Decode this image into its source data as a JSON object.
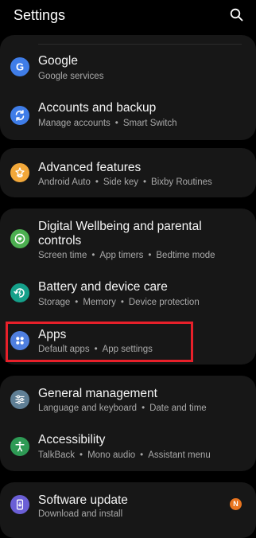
{
  "header": {
    "title": "Settings",
    "search_icon": "search-icon"
  },
  "colors": {
    "background": "#000000",
    "card": "#171717",
    "highlight": "#e8202a",
    "badge": "#e8741f",
    "google": "#3f7de8",
    "accounts": "#3f7de8",
    "advanced": "#f2a83a",
    "wellbeing": "#4caf50",
    "battery": "#15a08a",
    "apps": "#4f7fe0",
    "general": "#5f7f95",
    "accessibility": "#2e9a55",
    "software_update": "#6b5fd6"
  },
  "items": [
    {
      "label": "Google",
      "subs": [
        "Google services"
      ],
      "icon": "google-icon"
    },
    {
      "label": "Accounts and backup",
      "subs": [
        "Manage accounts",
        "Smart Switch"
      ],
      "icon": "sync-icon"
    },
    {
      "label": "Advanced features",
      "subs": [
        "Android Auto",
        "Side key",
        "Bixby Routines"
      ],
      "icon": "advanced-features-icon"
    },
    {
      "label_line1": "Digital Wellbeing and parental",
      "label_line2": "controls",
      "subs": [
        "Screen time",
        "App timers",
        "Bedtime mode"
      ],
      "icon": "wellbeing-icon"
    },
    {
      "label": "Battery and device care",
      "subs": [
        "Storage",
        "Memory",
        "Device protection"
      ],
      "icon": "device-care-icon"
    },
    {
      "label": "Apps",
      "subs": [
        "Default apps",
        "App settings"
      ],
      "icon": "apps-icon",
      "highlighted": true
    },
    {
      "label": "General management",
      "subs": [
        "Language and keyboard",
        "Date and time"
      ],
      "icon": "sliders-icon"
    },
    {
      "label": "Accessibility",
      "subs": [
        "TalkBack",
        "Mono audio",
        "Assistant menu"
      ],
      "icon": "accessibility-icon"
    },
    {
      "label": "Software update",
      "subs": [
        "Download and install"
      ],
      "icon": "software-update-icon",
      "badge": "N"
    }
  ],
  "separator": "•"
}
